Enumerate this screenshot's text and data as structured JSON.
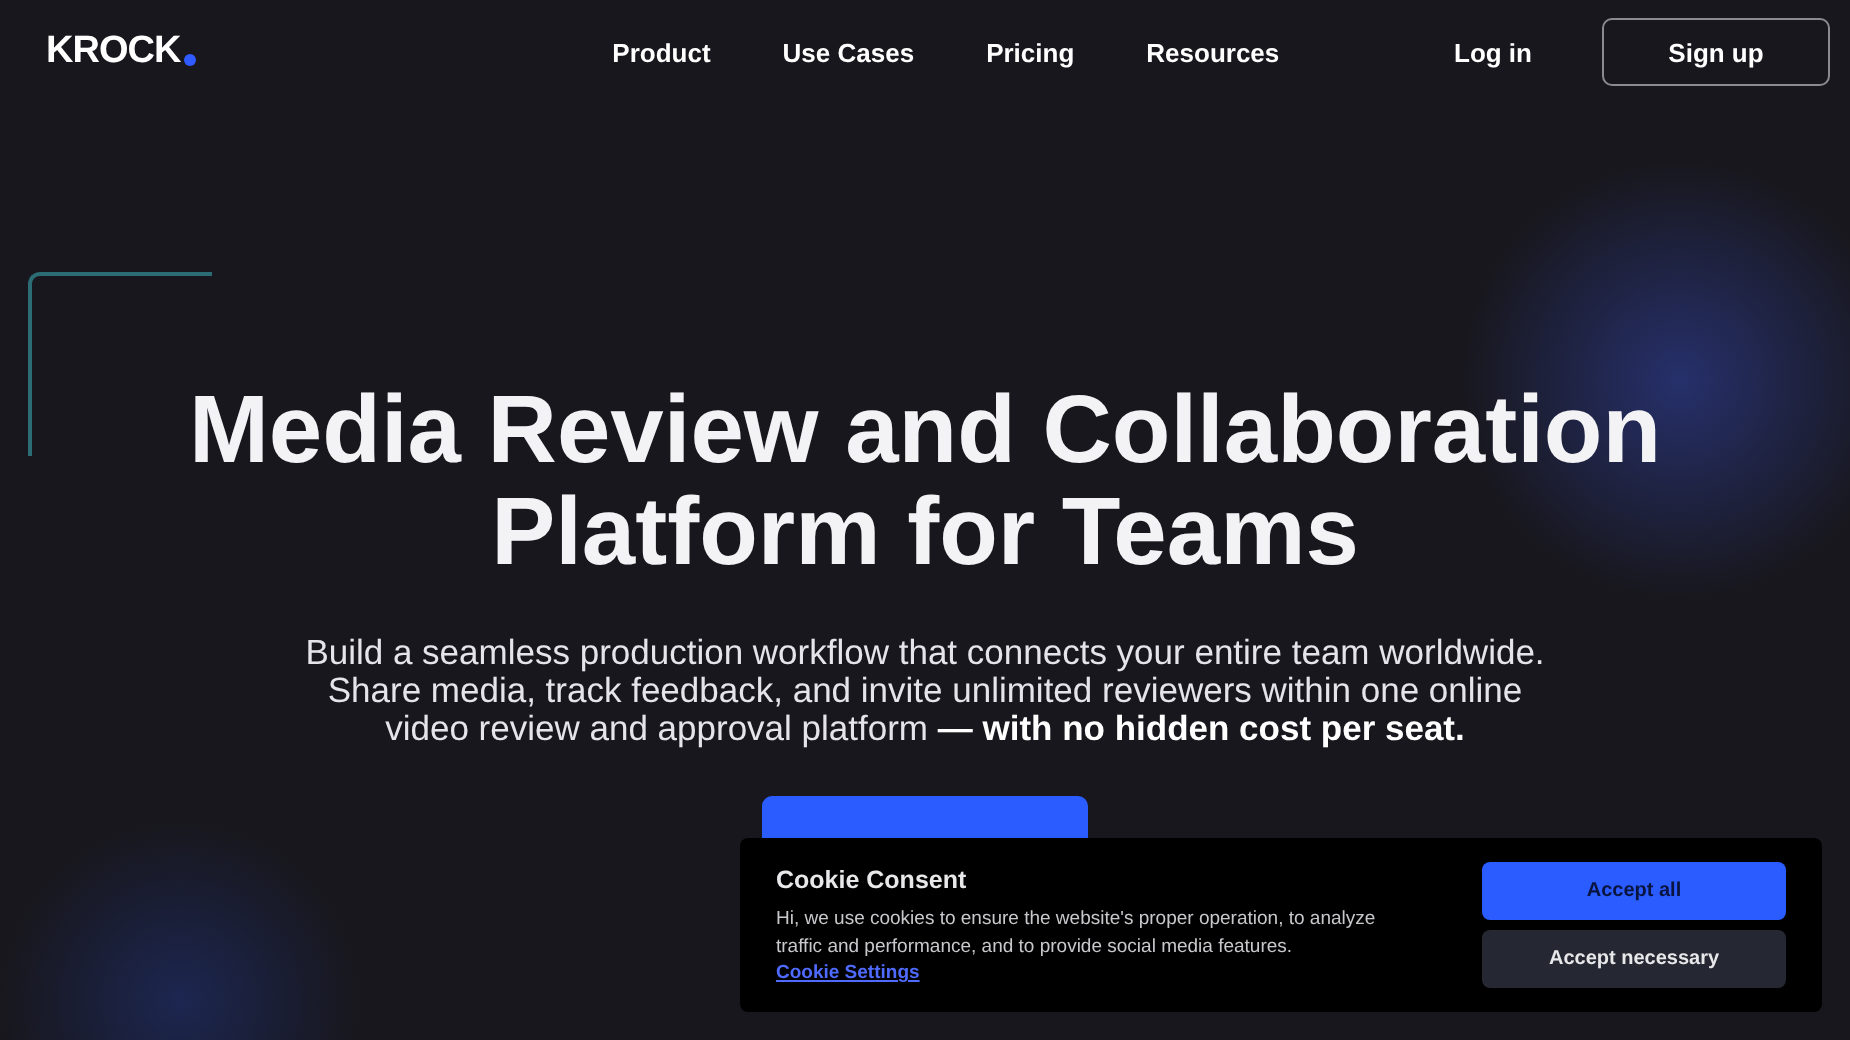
{
  "header": {
    "logo": "KROCK",
    "nav": [
      "Product",
      "Use Cases",
      "Pricing",
      "Resources"
    ],
    "login": "Log in",
    "signup": "Sign up"
  },
  "hero": {
    "title_lines": [
      "Media Review and Collaboration",
      "Platform for Teams"
    ],
    "subtitle": "Build a seamless production workflow that connects your entire team worldwide. Share media, track feedback, and invite unlimited reviewers within one online video review and approval platform **— with no hidden cost per seat.**"
  },
  "cookie_banner": {
    "title": "Cookie Consent",
    "text": "Hi, we use cookies to ensure the website's proper operation, to analyze traffic and performance, and to provide social media features.",
    "link": "Cookie Settings",
    "buttons": [
      {
        "label": "Accept all",
        "kind": "primary"
      },
      {
        "label": "Accept necessary",
        "kind": "secondary"
      }
    ]
  }
}
